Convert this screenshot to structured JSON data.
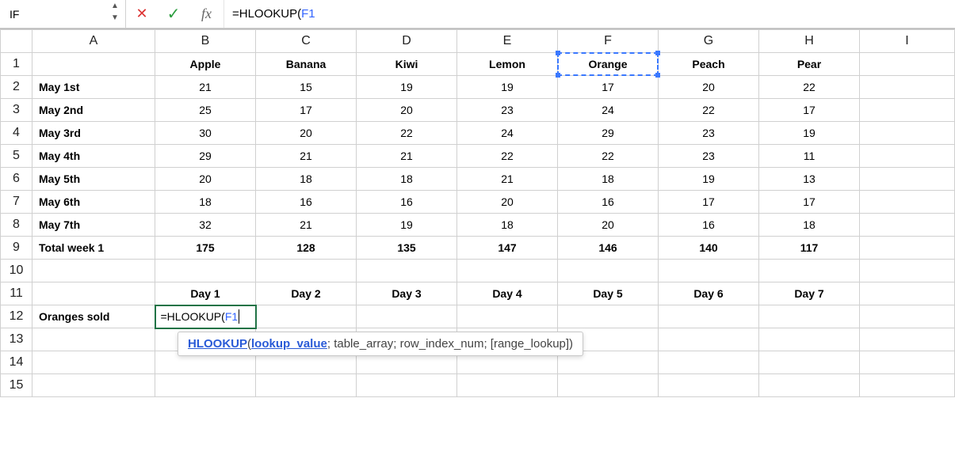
{
  "formula_bar": {
    "name_box": "IF",
    "cancel_icon": "✕",
    "confirm_icon": "✓",
    "fx_label": "fx",
    "formula_prefix": "=HLOOKUP(",
    "formula_ref": "F1"
  },
  "columns": [
    "A",
    "B",
    "C",
    "D",
    "E",
    "F",
    "G",
    "H",
    "I"
  ],
  "row_numbers": [
    "1",
    "2",
    "3",
    "4",
    "5",
    "6",
    "7",
    "8",
    "9",
    "10",
    "11",
    "12",
    "13",
    "14",
    "15"
  ],
  "headers_row1": {
    "A": "",
    "B": "Apple",
    "C": "Banana",
    "D": "Kiwi",
    "E": "Lemon",
    "F": "Orange",
    "G": "Peach",
    "H": "Pear"
  },
  "data_rows": [
    {
      "A": "May 1st",
      "B": "21",
      "C": "15",
      "D": "19",
      "E": "19",
      "F": "17",
      "G": "20",
      "H": "22"
    },
    {
      "A": "May 2nd",
      "B": "25",
      "C": "17",
      "D": "20",
      "E": "23",
      "F": "24",
      "G": "22",
      "H": "17"
    },
    {
      "A": "May 3rd",
      "B": "30",
      "C": "20",
      "D": "22",
      "E": "24",
      "F": "29",
      "G": "23",
      "H": "19"
    },
    {
      "A": "May 4th",
      "B": "29",
      "C": "21",
      "D": "21",
      "E": "22",
      "F": "22",
      "G": "23",
      "H": "11"
    },
    {
      "A": "May 5th",
      "B": "20",
      "C": "18",
      "D": "18",
      "E": "21",
      "F": "18",
      "G": "19",
      "H": "13"
    },
    {
      "A": "May 6th",
      "B": "18",
      "C": "16",
      "D": "16",
      "E": "20",
      "F": "16",
      "G": "17",
      "H": "17"
    },
    {
      "A": "May 7th",
      "B": "32",
      "C": "21",
      "D": "19",
      "E": "18",
      "F": "20",
      "G": "16",
      "H": "18"
    }
  ],
  "total_row": {
    "A": "Total week 1",
    "B": "175",
    "C": "128",
    "D": "135",
    "E": "147",
    "F": "146",
    "G": "140",
    "H": "117"
  },
  "days_row": {
    "A": "",
    "B": "Day 1",
    "C": "Day 2",
    "D": "Day 3",
    "E": "Day 4",
    "F": "Day 5",
    "G": "Day 6",
    "H": "Day 7"
  },
  "row12": {
    "A": "Oranges sold",
    "B_prefix": "=HLOOKUP(",
    "B_ref": "F1"
  },
  "tooltip": {
    "fn": "HLOOKUP",
    "open": "(",
    "arg1": "lookup_value",
    "rest": "; table_array; row_index_num; [range_lookup])"
  }
}
